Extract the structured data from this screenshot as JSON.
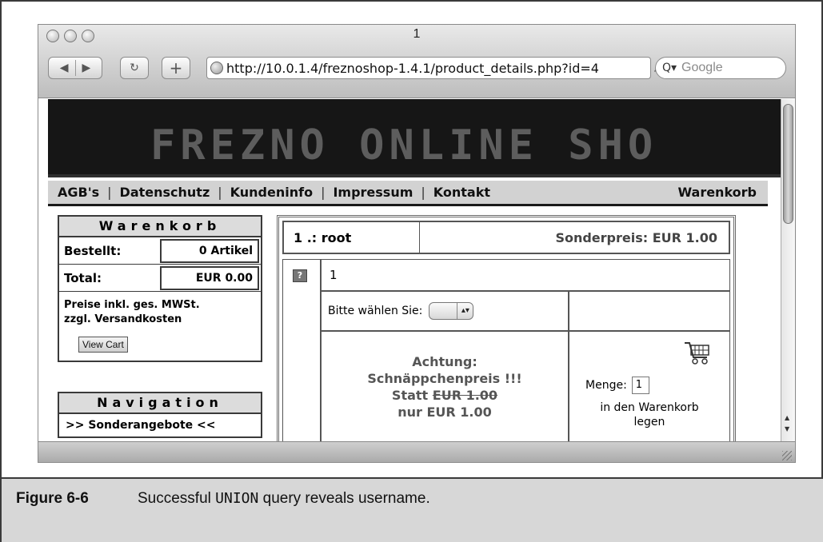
{
  "browser": {
    "window_title": "1",
    "url": "http://10.0.1.4/freznoshop-1.4.1/product_details.php?id=4",
    "search_placeholder": "Google"
  },
  "page": {
    "banner_text": "FREZNO ONLINE SHO",
    "topnav": {
      "agb": "AGB's",
      "datenschutz": "Datenschutz",
      "kundeninfo": "Kundeninfo",
      "impressum": "Impressum",
      "kontakt": "Kontakt",
      "warenkorb": "Warenkorb",
      "separator": "|"
    },
    "cart_box": {
      "title": "Warenkorb",
      "ordered_label": "Bestellt:",
      "ordered_value": "0 Artikel",
      "total_label": "Total:",
      "total_value": "EUR 0.00",
      "note_line1": "Preise inkl. ges. MWSt.",
      "note_line2": "zzgl. Versandkosten",
      "view_cart": "View Cart"
    },
    "nav_box": {
      "title": "Navigation",
      "link_special": ">> Sonderangebote <<"
    },
    "product": {
      "name": "1 .: root",
      "special_price": "Sonderpreis:  EUR 1.00",
      "thumb_placeholder": "?",
      "title": "1",
      "choose_label": "Bitte wählen Sie:",
      "offer_line1": "Achtung:",
      "offer_line2": "Schnäppchenpreis !!!",
      "offer_statt": "Statt",
      "offer_old_price": "EUR 1.00",
      "offer_line4": "nur EUR 1.00",
      "quantity_label": "Menge:",
      "quantity_value": "1",
      "add_to_cart_line1": "in den Warenkorb",
      "add_to_cart_line2": "legen"
    }
  },
  "caption": {
    "label": "Figure 6-6",
    "text_before": "Successful ",
    "code": "UNION",
    "text_after": " query reveals username."
  }
}
